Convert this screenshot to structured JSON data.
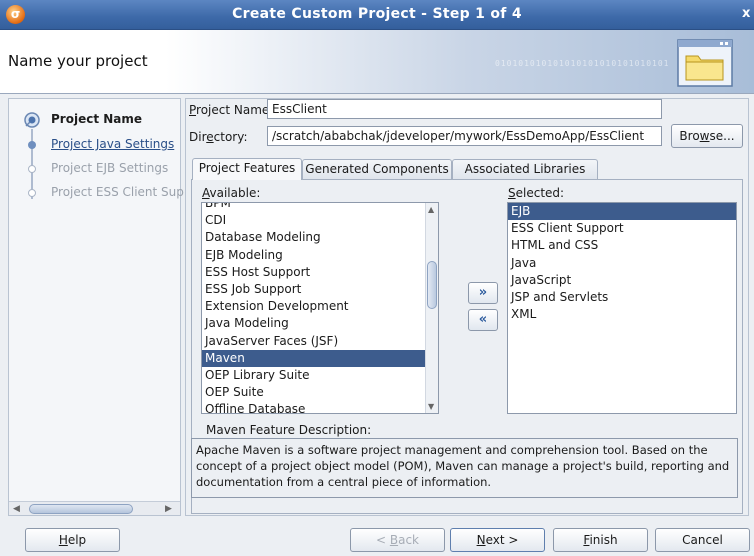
{
  "window": {
    "title": "Create Custom Project - Step 1 of 4",
    "close_glyph": "x"
  },
  "header": {
    "title": "Name your project",
    "binary_text": "010101010101010101010101010101"
  },
  "steps": [
    {
      "label": "Project Name",
      "state": "active"
    },
    {
      "label": "Project Java Settings",
      "state": "link"
    },
    {
      "label": "Project EJB Settings",
      "state": "dim"
    },
    {
      "label": "Project ESS Client Sup",
      "state": "dim"
    }
  ],
  "form": {
    "project_name_label_pre": "",
    "project_name_label_key": "P",
    "project_name_label_post": "roject Name:",
    "project_name_value": "EssClient",
    "directory_label_pre": "Dir",
    "directory_label_key": "e",
    "directory_label_post": "ctory:",
    "directory_value": "/scratch/ababchak/jdeveloper/mywork/EssDemoApp/EssClient",
    "browse_pre": "Bro",
    "browse_key": "w",
    "browse_post": "se..."
  },
  "tabs": [
    {
      "label": "Project Features",
      "active": true
    },
    {
      "label": "Generated Components",
      "active": false
    },
    {
      "label": "Associated Libraries",
      "active": false
    }
  ],
  "available": {
    "label_key": "A",
    "label_post": "vailable:",
    "items": [
      "BPM",
      "CDI",
      "Database Modeling",
      "EJB Modeling",
      "ESS Host Support",
      "ESS Job Support",
      "Extension Development",
      "Java Modeling",
      "JavaServer Faces (JSF)",
      "Maven",
      "OEP Library Suite",
      "OEP Suite",
      "Offline Database"
    ],
    "selected_index": 9
  },
  "selected": {
    "label_key": "S",
    "label_post": "elected:",
    "items": [
      "EJB",
      "ESS Client Support",
      "HTML and CSS",
      "Java",
      "JavaScript",
      "JSP and Servlets",
      "XML"
    ],
    "selected_index": 0
  },
  "move_buttons": {
    "add": "»",
    "remove": "«"
  },
  "description": {
    "label": "Maven Feature Description:",
    "text": "Apache Maven is a software project management and comprehension tool. Based on the concept of a project object model (POM), Maven can manage a project's build, reporting and documentation from a central piece of information."
  },
  "footer": {
    "help_key": "H",
    "help_post": "elp",
    "back_pre": "< ",
    "back_key": "B",
    "back_post": "ack",
    "next_key": "N",
    "next_post": "ext >",
    "finish_key": "F",
    "finish_post": "inish",
    "cancel": "Cancel"
  },
  "colors": {
    "titlebar": "#3d69a8",
    "selection": "#3d5c8d",
    "window_bg": "#eceff3"
  }
}
